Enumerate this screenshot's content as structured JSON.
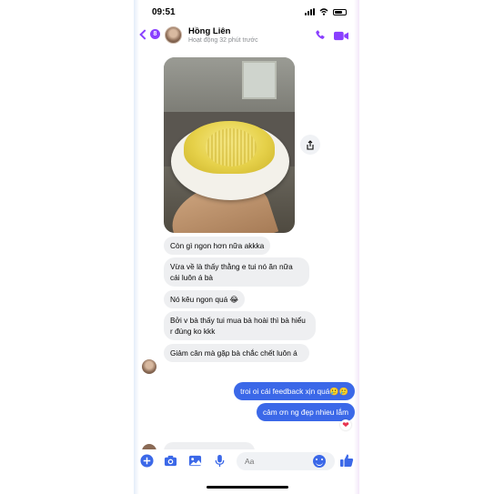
{
  "status_bar": {
    "time": "09:51"
  },
  "header": {
    "back_badge": "8",
    "contact_name": "Hồng Liên",
    "contact_status": "Hoạt động 32 phút trước"
  },
  "messages": [
    {
      "direction": "in",
      "text": "Còn gì ngon hơn nữa akkka"
    },
    {
      "direction": "in",
      "text": "Vừa về là thấy thằng e tui nó ăn nữa cái luôn á bà"
    },
    {
      "direction": "in",
      "text": "Nó kêu ngon quá 😂"
    },
    {
      "direction": "in",
      "text": "Bởi v bà thấy tui mua bà hoài thì bà hiểu r đúng ko kkk"
    },
    {
      "direction": "in",
      "text": "Giảm cân mà gặp bà chắc chết luôn á"
    },
    {
      "direction": "out",
      "text": "troi oi cái feedback xịn quá🥲🥲"
    },
    {
      "direction": "out",
      "text": "cảm ơn ng đẹp nhieu lắm"
    }
  ],
  "reaction": "❤",
  "composer": {
    "placeholder": "Aa"
  },
  "colors": {
    "accent": "#8a40ff",
    "outgoing": "#3b68e8",
    "incoming": "#eeeff1"
  },
  "icons": [
    "phone-icon",
    "video-icon",
    "plus-icon",
    "camera-icon",
    "gallery-icon",
    "microphone-icon",
    "emoji-icon",
    "thumbs-up-icon",
    "share-icon"
  ]
}
